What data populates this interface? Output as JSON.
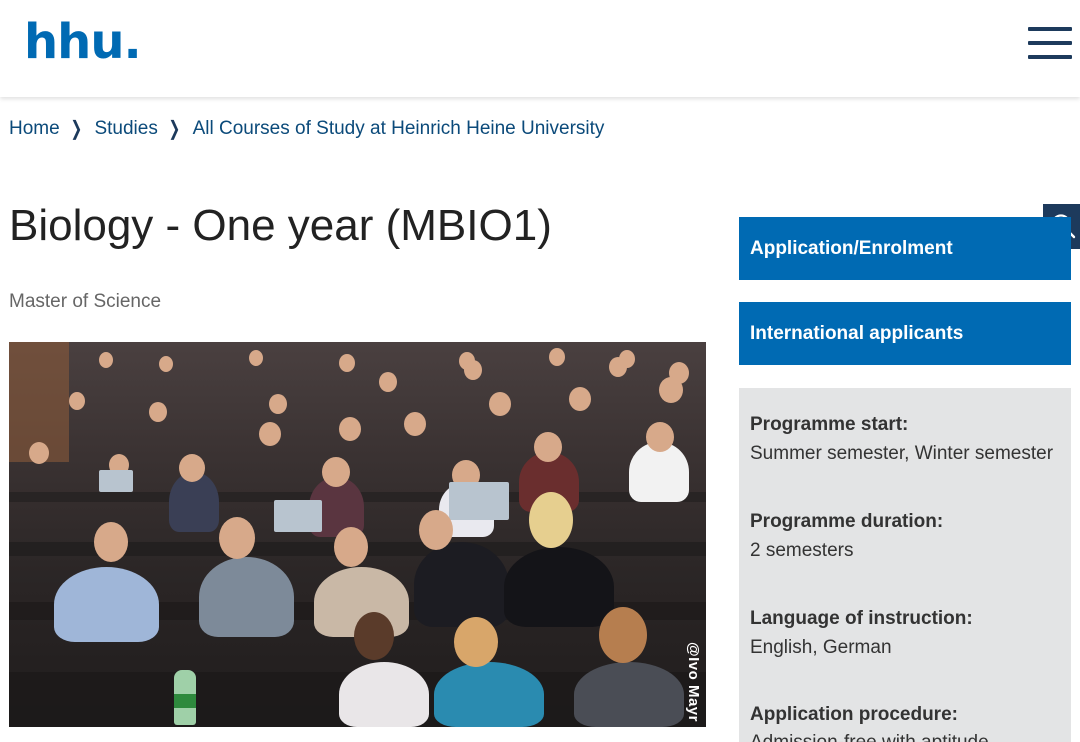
{
  "header": {
    "logo_text": "hhu.",
    "menu_icon": "hamburger-menu-icon"
  },
  "breadcrumb": {
    "items": [
      "Home",
      "Studies",
      "All Courses of Study at Heinrich Heine University"
    ],
    "separator_icon": "chevron-right-icon"
  },
  "page": {
    "title": "Biology - One year (MBIO1)",
    "degree": "Master of Science"
  },
  "photo": {
    "credit": "@Ivo Mayr"
  },
  "sidebar": {
    "buttons": [
      "Application/Enrolment",
      "International applicants"
    ],
    "search_icon": "search-icon",
    "info": [
      {
        "label": "Programme start:",
        "value": "Summer semester, Winter semester"
      },
      {
        "label": "Programme duration:",
        "value": "2 semesters"
      },
      {
        "label": "Language of instruction:",
        "value": "English, German"
      },
      {
        "label": "Application procedure:",
        "value": "Admission-free with aptitude"
      }
    ]
  },
  "colors": {
    "brand_blue": "#006ab3",
    "dark_navy": "#1d3a5c",
    "info_bg": "#e3e4e5"
  }
}
